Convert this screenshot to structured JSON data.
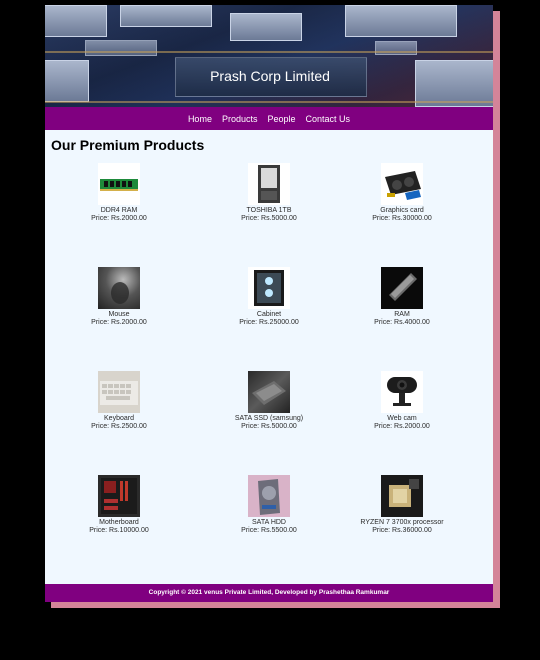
{
  "header": {
    "title": "Prash Corp Limited"
  },
  "nav": {
    "items": [
      "Home",
      "Products",
      "People",
      "Contact Us"
    ]
  },
  "main": {
    "heading": "Our Premium Products",
    "products": [
      {
        "name": "DDR4 RAM",
        "price": "Price: Rs.2000.00",
        "icon": "ram-stick-icon"
      },
      {
        "name": "TOSHIBA 1TB",
        "price": "Price: Rs.5000.00",
        "icon": "hard-drive-icon"
      },
      {
        "name": "Graphics card",
        "price": "Price: Rs.30000.00",
        "icon": "graphics-card-icon"
      },
      {
        "name": "Mouse",
        "price": "Price: Rs.2000.00",
        "icon": "mouse-icon"
      },
      {
        "name": "Cabinet",
        "price": "Price: Rs.25000.00",
        "icon": "cabinet-icon"
      },
      {
        "name": "RAM",
        "price": "Price: Rs.4000.00",
        "icon": "ram-icon"
      },
      {
        "name": "Keyboard",
        "price": "Price: Rs.2500.00",
        "icon": "keyboard-icon"
      },
      {
        "name": "SATA SSD (samsung)",
        "price": "Price: Rs.5000.00",
        "icon": "ssd-icon"
      },
      {
        "name": "Web cam",
        "price": "Price: Rs.2000.00",
        "icon": "webcam-icon"
      },
      {
        "name": "Motherboard",
        "price": "Price: Rs.10000.00",
        "icon": "motherboard-icon"
      },
      {
        "name": "SATA HDD",
        "price": "Price: Rs.5500.00",
        "icon": "hdd-icon"
      },
      {
        "name": "RYZEN 7 3700x processor",
        "price": "Price: Rs.36000.00",
        "icon": "processor-icon"
      }
    ]
  },
  "footer": {
    "text": "Copyright © 2021 venus Private Limited, Developed by Prashethaa Ramkumar"
  },
  "colors": {
    "nav": "#800080",
    "page_bg": "#f0f8ff",
    "outer_bg": "#000000",
    "shadow": "#d48499"
  }
}
